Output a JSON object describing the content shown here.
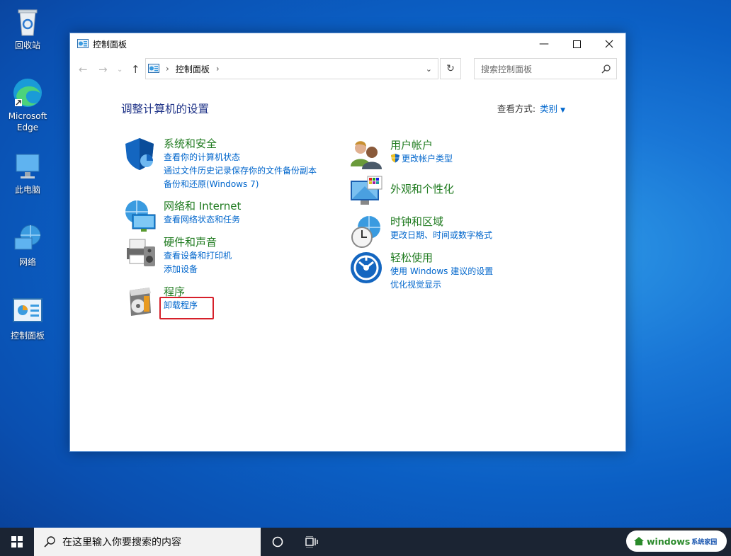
{
  "desktop": {
    "icons": [
      {
        "name": "recycle-bin",
        "label": "回收站"
      },
      {
        "name": "edge",
        "label": "Microsoft Edge"
      },
      {
        "name": "this-pc",
        "label": "此电脑"
      },
      {
        "name": "network",
        "label": "网络"
      },
      {
        "name": "control-panel",
        "label": "控制面板"
      }
    ]
  },
  "window": {
    "title": "控制面板",
    "breadcrumb": "控制面板",
    "search_placeholder": "搜索控制面板",
    "heading": "调整计算机的设置",
    "view_by_label": "查看方式:",
    "view_by_value": "类别",
    "categories_left": [
      {
        "title": "系统和安全",
        "links": [
          "查看你的计算机状态",
          "通过文件历史记录保存你的文件备份副本",
          "备份和还原(Windows 7)"
        ]
      },
      {
        "title": "网络和 Internet",
        "links": [
          "查看网络状态和任务"
        ]
      },
      {
        "title": "硬件和声音",
        "links": [
          "查看设备和打印机",
          "添加设备"
        ]
      },
      {
        "title": "程序",
        "links": [
          "卸载程序"
        ]
      }
    ],
    "categories_right": [
      {
        "title": "用户帐户",
        "links": [
          "更改帐户类型"
        ]
      },
      {
        "title": "外观和个性化",
        "links": []
      },
      {
        "title": "时钟和区域",
        "links": [
          "更改日期、时间或数字格式"
        ]
      },
      {
        "title": "轻松使用",
        "links": [
          "使用 Windows 建议的设置",
          "优化视觉显示"
        ]
      }
    ]
  },
  "taskbar": {
    "search_placeholder": "在这里输入你要搜索的内容"
  },
  "watermark": {
    "text": "windows",
    "suffix": "系统家园"
  }
}
